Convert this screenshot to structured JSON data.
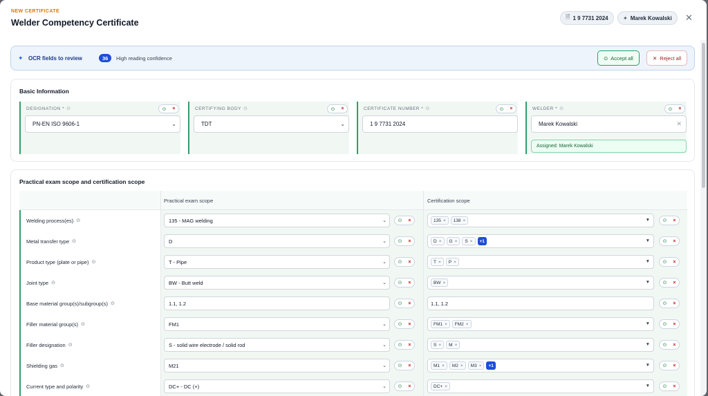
{
  "header": {
    "kicker": "NEW CERTIFICATE",
    "title": "Welder Competency Certificate",
    "doc_chip": "1 9 7731 2024",
    "welder_chip": "Marek Kowalski"
  },
  "ocr": {
    "label": "OCR fields to review",
    "count": "36",
    "confidence": "High reading confidence",
    "accept_label": "Accept all",
    "reject_label": "Reject all"
  },
  "basic": {
    "title": "Basic Information",
    "fields": [
      {
        "label": "DESIGNATION *",
        "value": "PN-EN ISO 9606-1",
        "kind": "select"
      },
      {
        "label": "CERTIFYING BODY",
        "value": "TDT",
        "kind": "select"
      },
      {
        "label": "CERTIFICATE NUMBER *",
        "value": "1 9 7731 2024",
        "kind": "input"
      },
      {
        "label": "WELDER *",
        "value": "Marek Kowalski",
        "kind": "input",
        "assigned": "Assigned: Marek Kowalski"
      }
    ]
  },
  "scope": {
    "title": "Practical exam scope and certification scope",
    "col_exam": "Practical exam scope",
    "col_cert": "Certification scope",
    "rows": [
      {
        "label": "Welding process(es)",
        "exam": "135 - MAG welding",
        "exam_kind": "select",
        "cert_tags": [
          "135",
          "138"
        ],
        "cert_more": "",
        "cert_kind": "tags"
      },
      {
        "label": "Metal transfer type",
        "exam": "D",
        "exam_kind": "select",
        "cert_tags": [
          "D",
          "G",
          "S"
        ],
        "cert_more": "+1",
        "cert_kind": "tags"
      },
      {
        "label": "Product type (plate or pipe)",
        "exam": "T - Pipe",
        "exam_kind": "select",
        "cert_tags": [
          "T",
          "P"
        ],
        "cert_more": "",
        "cert_kind": "tags"
      },
      {
        "label": "Joint type",
        "exam": "BW - Butt weld",
        "exam_kind": "select",
        "cert_tags": [
          "BW"
        ],
        "cert_more": "",
        "cert_kind": "tags"
      },
      {
        "label": "Base material group(s)/subgroup(s)",
        "exam": "1.1, 1.2",
        "exam_kind": "input",
        "cert_text": "1.1, 1.2",
        "cert_kind": "input"
      },
      {
        "label": "Filler material group(s)",
        "exam": "FM1",
        "exam_kind": "select",
        "cert_tags": [
          "FM1",
          "FM2"
        ],
        "cert_more": "",
        "cert_kind": "tags"
      },
      {
        "label": "Filler designation",
        "exam": "S - solid wire electrode / solid rod",
        "exam_kind": "select",
        "cert_tags": [
          "S",
          "M"
        ],
        "cert_more": "",
        "cert_kind": "tags"
      },
      {
        "label": "Shielding gas",
        "exam": "M21",
        "exam_kind": "select",
        "cert_tags": [
          "M1",
          "M2",
          "M3"
        ],
        "cert_more": "+1",
        "cert_kind": "tags"
      },
      {
        "label": "Current type and polarity",
        "exam": "DC+ - DC (+)",
        "exam_kind": "select",
        "cert_tags": [
          "DC+"
        ],
        "cert_more": "",
        "cert_kind": "tags"
      }
    ]
  }
}
